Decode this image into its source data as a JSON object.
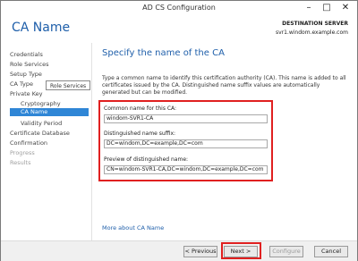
{
  "window": {
    "title": "AD CS Configuration",
    "minimize_glyph": "–",
    "maximize_glyph": "□",
    "close_glyph": "✕"
  },
  "header": {
    "page_title": "CA Name",
    "destination_label": "DESTINATION SERVER",
    "destination_value": "svr1.windom.example.com"
  },
  "nav": {
    "items": [
      {
        "label": "Credentials"
      },
      {
        "label": "Role Services"
      },
      {
        "label": "Setup Type"
      },
      {
        "label": "CA Type"
      },
      {
        "label": "Private Key"
      },
      {
        "label": "Cryptography"
      },
      {
        "label": "CA Name"
      },
      {
        "label": "Validity Period"
      },
      {
        "label": "Certificate Database"
      },
      {
        "label": "Confirmation"
      },
      {
        "label": "Progress"
      },
      {
        "label": "Results"
      }
    ],
    "tooltip": "Role Services"
  },
  "content": {
    "heading": "Specify the name of the CA",
    "description": "Type a common name to identify this certification authority (CA). This name is added to all certificates issued by the CA. Distinguished name suffix values are automatically generated but can be modified.",
    "common_name_label": "Common name for this CA:",
    "common_name_value": "windom-SVR1-CA",
    "dn_suffix_label": "Distinguished name suffix:",
    "dn_suffix_value": "DC=windom,DC=example,DC=com",
    "preview_label": "Preview of distinguished name:",
    "preview_value": "CN=windom-SVR1-CA,DC=windom,DC=example,DC=com",
    "more_link": "More about CA Name"
  },
  "footer": {
    "previous": "< Previous",
    "next": "Next >",
    "configure": "Configure",
    "cancel": "Cancel"
  }
}
